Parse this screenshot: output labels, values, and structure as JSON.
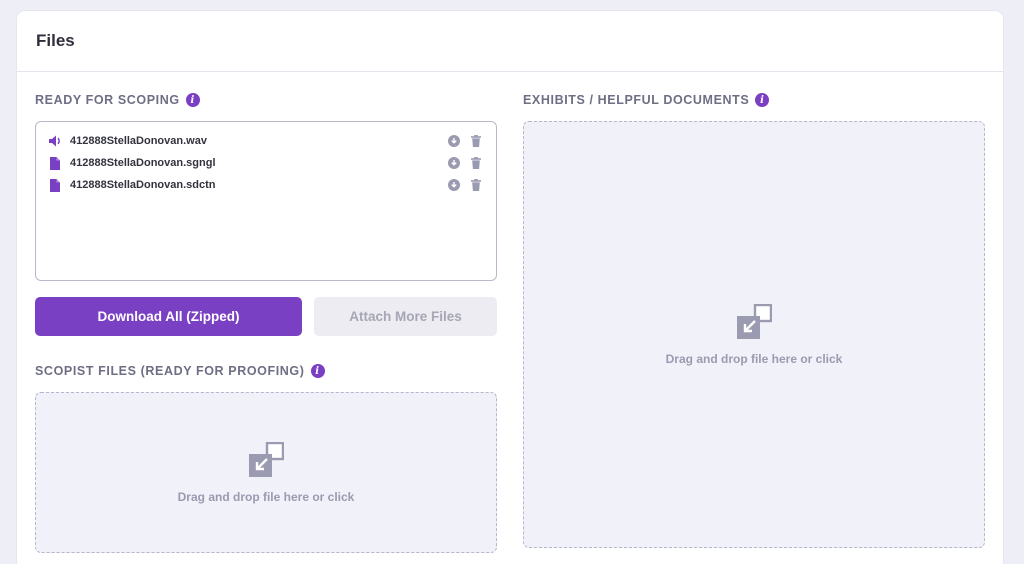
{
  "header": {
    "title": "Files"
  },
  "ready_for_scoping": {
    "label": "READY FOR SCOPING",
    "files": [
      {
        "name": "412888StellaDonovan.wav",
        "icon": "audio-icon"
      },
      {
        "name": "412888StellaDonovan.sgngl",
        "icon": "file-icon"
      },
      {
        "name": "412888StellaDonovan.sdctn",
        "icon": "file-icon"
      }
    ],
    "download_all_label": "Download All (Zipped)",
    "attach_more_label": "Attach More Files"
  },
  "scopist_files": {
    "label": "SCOPIST FILES (READY FOR PROOFING)",
    "dropzone_text": "Drag and drop file here or click"
  },
  "exhibits": {
    "label": "EXHIBITS / HELPFUL DOCUMENTS",
    "dropzone_text": "Drag and drop file here or click"
  },
  "colors": {
    "accent": "#7a40c4",
    "background": "#eeeef7",
    "dropzone_bg": "#f1f1f9",
    "icon_gray": "#9a9ab0"
  }
}
